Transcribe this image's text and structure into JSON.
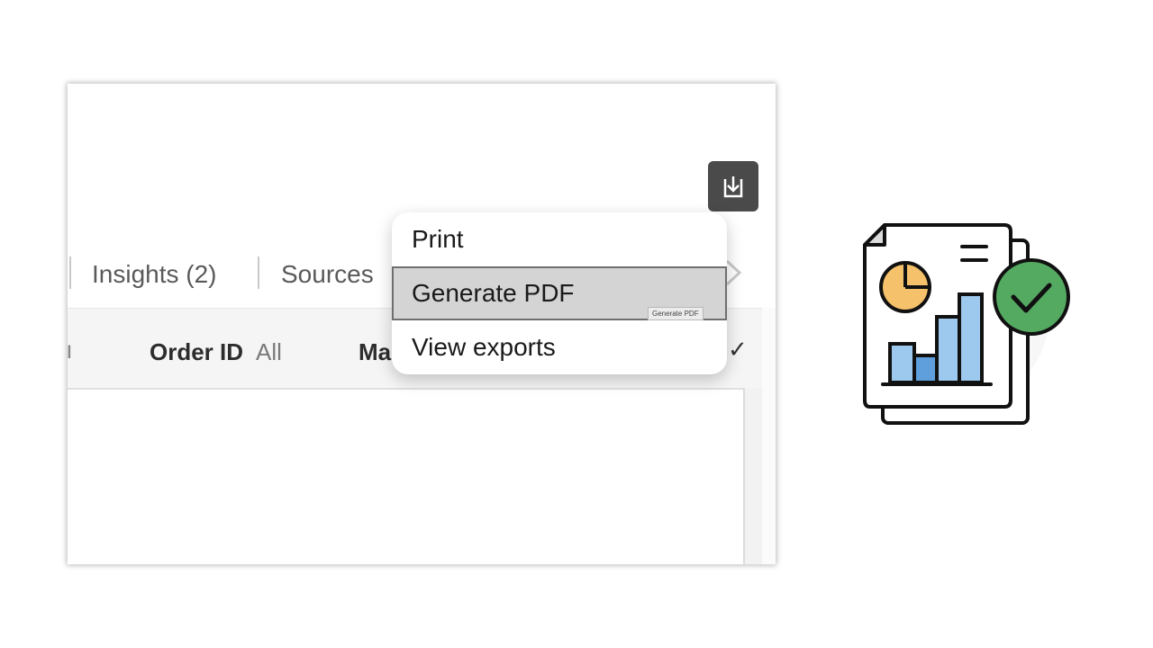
{
  "tabs": [
    {
      "label": "Insights (2)"
    },
    {
      "label": "Sources"
    }
  ],
  "filters": [
    {
      "name": "Order ID",
      "value": "All"
    },
    {
      "name": "Ma",
      "value": ""
    }
  ],
  "export_menu": {
    "items": [
      {
        "label": "Print"
      },
      {
        "label": "Generate PDF"
      },
      {
        "label": "View exports"
      }
    ],
    "hovered_index": 1,
    "tooltip": "Generate PDF"
  },
  "icons": {
    "export": "download-tray-icon",
    "tabs_more": "chevron-right-icon",
    "filter_apply": "checkmark-icon",
    "illustration": "report-document-check-icon"
  },
  "colors": {
    "export_button": "#4a4a4a",
    "menu_hover": "#d4d4d4",
    "pie": "#f5c26b",
    "bars": "#9ec9ee",
    "bars_shade": "#5f9fdc",
    "check_badge": "#55aa62"
  }
}
